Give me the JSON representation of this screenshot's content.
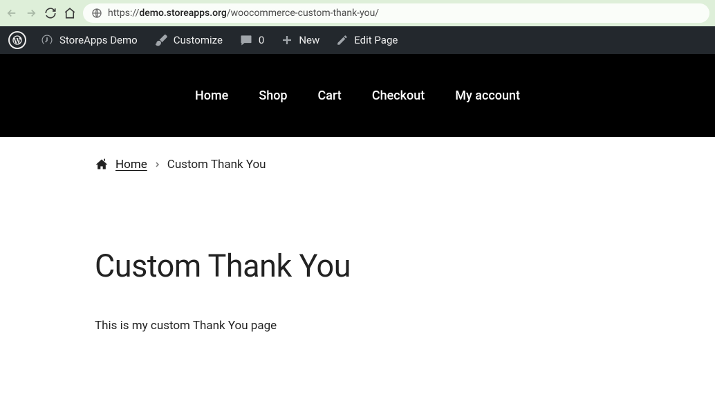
{
  "browser": {
    "url_scheme": "https://",
    "url_host": "demo.storeapps.org",
    "url_path": "/woocommerce-custom-thank-you/"
  },
  "wp_bar": {
    "site_name": "StoreApps Demo",
    "customize": "Customize",
    "comments_count": "0",
    "new": "New",
    "edit_page": "Edit Page"
  },
  "nav": {
    "items": [
      {
        "label": "Home"
      },
      {
        "label": "Shop"
      },
      {
        "label": "Cart"
      },
      {
        "label": "Checkout"
      },
      {
        "label": "My account"
      }
    ]
  },
  "breadcrumb": {
    "home": "Home",
    "current": "Custom Thank You"
  },
  "page": {
    "title": "Custom Thank You",
    "body": "This is my custom Thank You page"
  }
}
